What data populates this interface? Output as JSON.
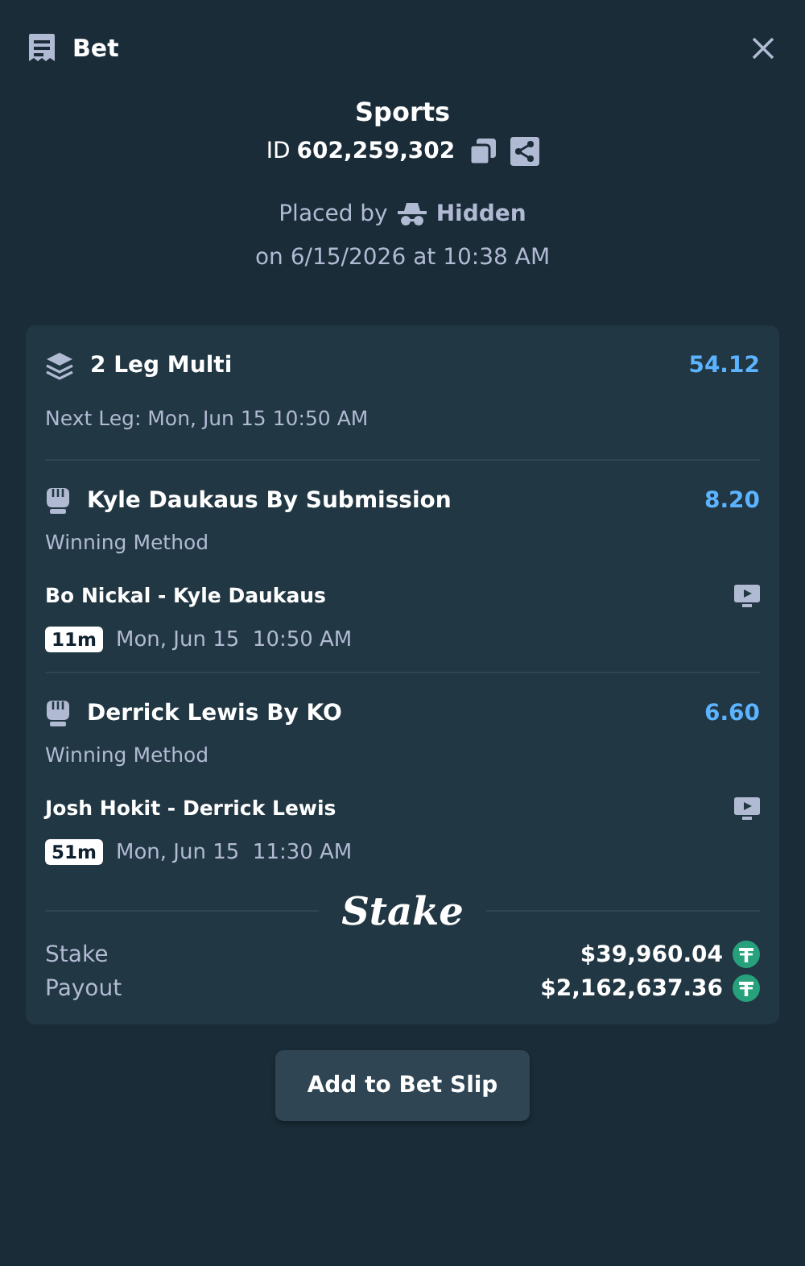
{
  "header": {
    "title": "Bet"
  },
  "summary": {
    "category": "Sports",
    "id_label": "ID",
    "id_value": "602,259,302",
    "placed_by_label": "Placed by",
    "placed_by_user": "Hidden",
    "placed_on": "on 6/15/2026 at 10:38 AM"
  },
  "multi": {
    "title": "2 Leg Multi",
    "odds": "54.12",
    "next_leg": "Next Leg: Mon, Jun 15 10:50 AM"
  },
  "legs": [
    {
      "selection": "Kyle Daukaus By Submission",
      "odds": "8.20",
      "market": "Winning Method",
      "match": "Bo Nickal - Kyle Daukaus",
      "countdown": "11m",
      "date": "Mon, Jun 15",
      "time": "10:50 AM"
    },
    {
      "selection": "Derrick Lewis By KO",
      "odds": "6.60",
      "market": "Winning Method",
      "match": "Josh Hokit - Derrick Lewis",
      "countdown": "51m",
      "date": "Mon, Jun 15",
      "time": "11:30 AM"
    }
  ],
  "logo": "Stake",
  "totals": [
    {
      "label": "Stake",
      "amount": "$39,960.04"
    },
    {
      "label": "Payout",
      "amount": "$2,162,637.36"
    }
  ],
  "action_button": "Add to Bet Slip"
}
